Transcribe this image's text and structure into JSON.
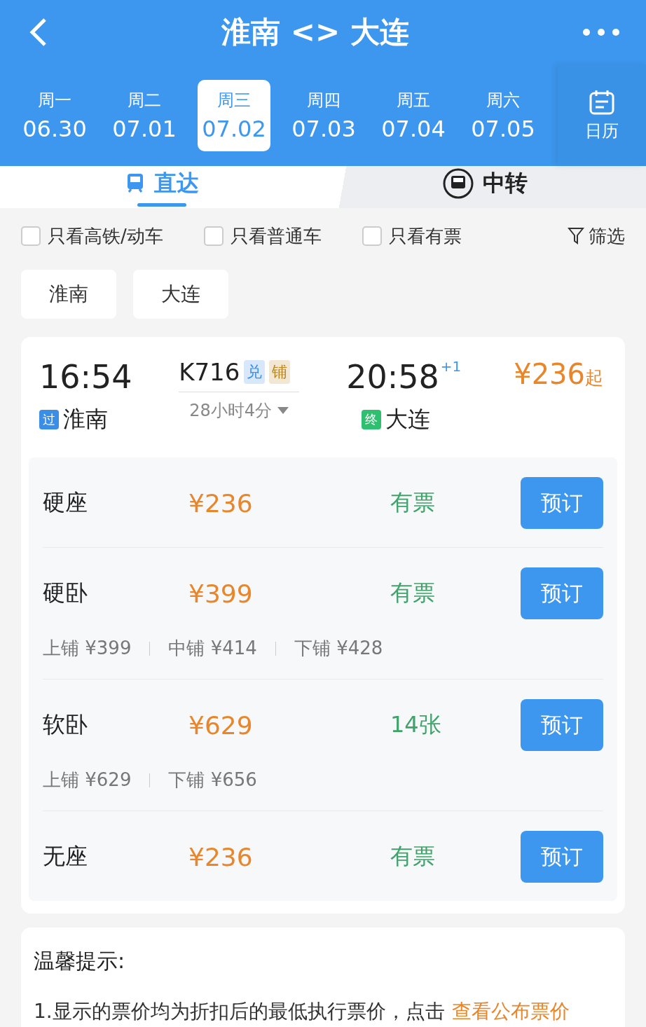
{
  "header": {
    "title": "淮南 <> 大连",
    "calendar_label": "日历",
    "dates": [
      {
        "weekday": "周一",
        "date": "06.30",
        "selected": false
      },
      {
        "weekday": "周二",
        "date": "07.01",
        "selected": false
      },
      {
        "weekday": "周三",
        "date": "07.02",
        "selected": true
      },
      {
        "weekday": "周四",
        "date": "07.03",
        "selected": false
      },
      {
        "weekday": "周五",
        "date": "07.04",
        "selected": false
      },
      {
        "weekday": "周六",
        "date": "07.05",
        "selected": false
      }
    ]
  },
  "tabs": [
    {
      "label": "直达",
      "selected": true
    },
    {
      "label": "中转",
      "selected": false
    }
  ],
  "filters": [
    {
      "label": "只看高铁/动车",
      "checked": false
    },
    {
      "label": "只看普通车",
      "checked": false
    },
    {
      "label": "只看有票",
      "checked": false
    }
  ],
  "filter_button": "筛选",
  "stations": [
    "淮南",
    "大连"
  ],
  "train": {
    "depart_time": "16:54",
    "depart_badge": {
      "label": "过",
      "color": "#3a8ee6"
    },
    "depart_station": "淮南",
    "number": "K716",
    "tags": [
      {
        "label": "兑",
        "color": "#3a8ee6"
      },
      {
        "label": "铺",
        "color": "#b8861c"
      }
    ],
    "duration": "28小时4分",
    "arrive_time": "20:58",
    "day_offset": "+1",
    "arrive_badge": {
      "label": "终",
      "color": "#2fbf71"
    },
    "arrive_station": "大连",
    "price": "¥236",
    "price_suffix": "起",
    "seats": [
      {
        "name": "硬座",
        "price": "¥236",
        "availability": "有票",
        "button": "预订"
      },
      {
        "name": "硬卧",
        "price": "¥399",
        "availability": "有票",
        "button": "预订",
        "berths": [
          "上铺 ¥399",
          "中铺 ¥414",
          "下铺 ¥428"
        ]
      },
      {
        "name": "软卧",
        "price": "¥629",
        "availability": "14张",
        "button": "预订",
        "berths": [
          "上铺 ¥629",
          "下铺 ¥656"
        ]
      },
      {
        "name": "无座",
        "price": "¥236",
        "availability": "有票",
        "button": "预订"
      }
    ]
  },
  "tips": {
    "title": "温馨提示:",
    "line": "1.显示的票价均为折扣后的最低执行票价，点击",
    "link": "查看公布票价"
  }
}
